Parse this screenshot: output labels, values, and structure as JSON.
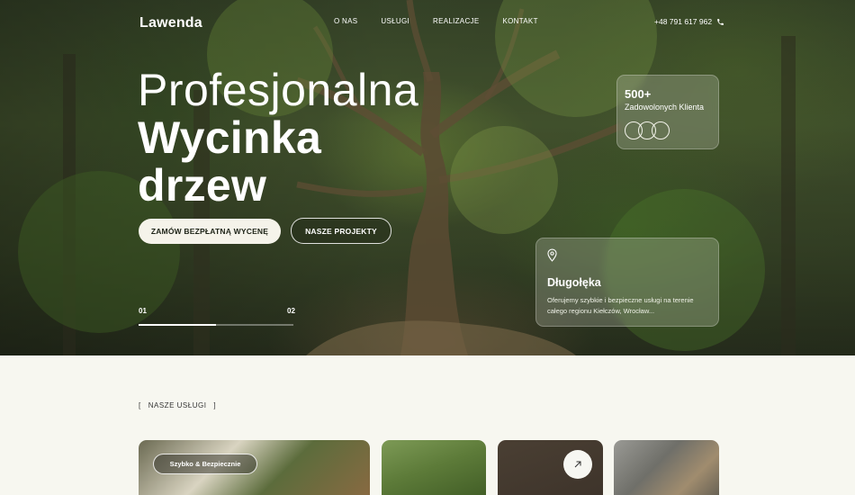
{
  "brand": {
    "logo": "Lawenda"
  },
  "nav": {
    "items": [
      "O NAS",
      "USŁUGI",
      "REALIZACJE",
      "KONTAKT"
    ]
  },
  "contact": {
    "phone": "+48 791 617 962"
  },
  "hero": {
    "headline_line1": "Profesjonalna",
    "headline_line2": "Wycinka",
    "headline_line3": "drzew",
    "primary_button": "ZAMÓW BEZPŁATNĄ WYCENĘ",
    "secondary_button": "NASZE PROJEKTY",
    "slider": {
      "current": "01",
      "next": "02",
      "progress_fraction": 0.5
    }
  },
  "stat_card": {
    "value": "500+",
    "label": "Zadowolonych Klienta",
    "avatar_count": 3
  },
  "location_card": {
    "title": "Długołęka",
    "description": "Oferujemy szybkie i bezpieczne usługi na terenie całego regionu Kiełczów, Wrocław..."
  },
  "services": {
    "section_label": "NASZE USŁUGI",
    "open_bracket": "[",
    "close_bracket": "]",
    "first_card_tag": "Szybko & Bezpiecznie"
  },
  "colors": {
    "accent": "#f5f3ea",
    "dark_text": "#1d2317",
    "page_bg": "#f7f7f0"
  }
}
